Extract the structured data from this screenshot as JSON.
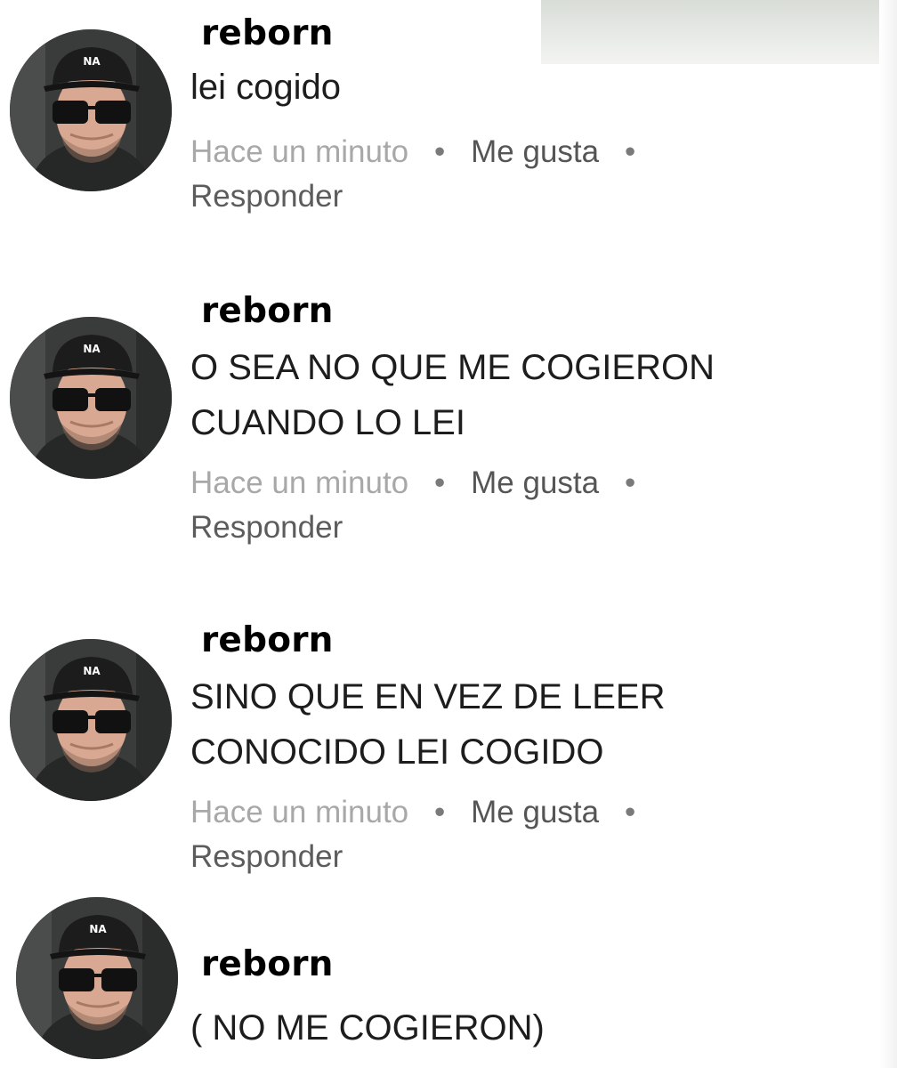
{
  "colors": {
    "username": "#000000",
    "comment_text": "#1d1d1d",
    "timestamp": "#a8a8a8",
    "action": "#555555",
    "background": "#ffffff"
  },
  "comments": [
    {
      "username": "reborn",
      "avatar_icon": "user-avatar-icon",
      "text": "lei cogido",
      "timestamp": "Hace un minuto",
      "separator": "•",
      "like_label": "Me gusta",
      "reply_label": "Responder"
    },
    {
      "username": "reborn",
      "avatar_icon": "user-avatar-icon",
      "text": "O SEA NO QUE ME COGIERON\nCUANDO LO LEI",
      "timestamp": "Hace un minuto",
      "separator": "•",
      "like_label": "Me gusta",
      "reply_label": "Responder"
    },
    {
      "username": "reborn",
      "avatar_icon": "user-avatar-icon",
      "text": "SINO QUE EN VEZ DE LEER\nCONOCIDO LEI COGIDO",
      "timestamp": "Hace un minuto",
      "separator": "•",
      "like_label": "Me gusta",
      "reply_label": "Responder"
    },
    {
      "username": "reborn",
      "avatar_icon": "user-avatar-icon",
      "text": "( NO ME COGIERON)"
    }
  ]
}
